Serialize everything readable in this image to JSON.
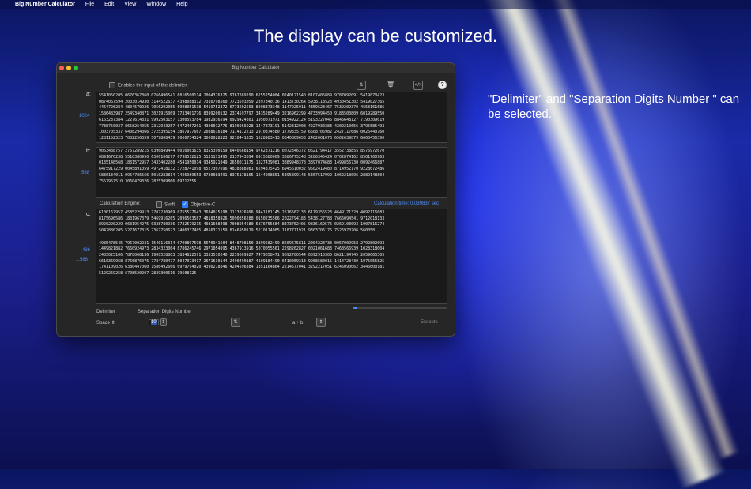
{
  "menubar": {
    "app_name": "Big Number Calculator",
    "items": [
      "File",
      "Edit",
      "View",
      "Window",
      "Help"
    ]
  },
  "headline": "The display can be customized.",
  "sidenote": "\"Delimiter\" and \"Separation Digits Number \" can be selected.",
  "window": {
    "title": "Big Number Calculator",
    "enable_delimiter_label": "Enables the input of the delimiter.",
    "a": {
      "label": "a:",
      "count": "1024",
      "text": "5541050205 0676367860 0766496541 6816500114 2004376325 9767889290 6255254084 0240121540 8107405889 9787092091 5419870423\n0874067594 2003014930 3144522637 4398088312 7310798560 7723593059 2397340736 1413730264 5938118523 4930451302 5419027365\n4464726284 4804570926 7056292055 6998051538 5419752372 6773202553 8008373348 1147925911 4359623467 7539209370 4653161686\n1586483987 2549340871 3021915069 1733401776 8399200132 2374597797 3435289449 3216962299 4733994450 9183503809 6019289550\n6163237384 1227614331 9992503157 1300593784 1932936594 0929424801 1950071971 0154922124 5193227045 8846648127 7190309019\n7738750027 8658264055 2312943257 6472467201 4300012776 8190966928 1447873191 5142312908 4227930383 4209210656 3795585493\n1003705337 6408294366 3725395154 3867977667 2088616184 7174172213 2970374580 1779335759 6608705982 2427117686 0025440760\n1281152323 7082256359 5079808439 9066734324 3000028323 9210441335 1528983413 0840809653 2402001073 6502639879 6660456390"
    },
    "b": {
      "label": "b:",
      "count": "588",
      "text": "9063438757 2767289215 6396849444 0010063635 8355390159 6440668154 9762371216 0072346372 0621794417 3552738855 8576972670\n0891670238 5518380950 6306106277 6798512125 5131171495 2137943894 0915680069 3386775248 3286345424 0702874162 8501760963\n0135148568 1831572957 3433402280 4541950014 9345921049 2650011175 1827439981 3889948378 3897074683 1499856730 0092466887\n6475917229 0045891059 4972418132 3728741098 6527307696 4838888981 6294375425 6945610032 9502419480 8714952170 9228672486\n5836134011 0964786566 5010283814 7426989553 6780083491 8375178165 1644008851 5395899143 5367517999 1062218096 2889148804\n7557957510 3060479326 7825309866 69712556"
    },
    "engine": {
      "label": "Calculation Engine:",
      "swift": "Swift",
      "objc": "Objective-C",
      "calc_time": "Calculation time: 0.039837 sec"
    },
    "c": {
      "label": "c:",
      "count1": "436",
      "count2": "...588",
      "text": "6100167957 4585229913 7707230969 0755527643 3634025198 1123826996 9441181145 2516562133 6179355523 4649171329 4092116083\n8175696586 1831967379 5469916265 2096503587 4818358926 5090856288 0150235566 2022794183 5438127788 7666094541 9712018133\n8920290229 0631954275 0338780936 1732579215 4081668498 7008954680 5876755684 8373752405 9836169576 0269103093 1907816274\n5042880205 5271677815 2367750623 2406337485 4856371159 8146950119 5210174985 1187771921 9303706175 7526970706 560058…\n\n4985478545 7967002231 1540116014 0700897598 5670941604 8448708150 3899582499 8669675811 2004223733 0057009958 2792802093\n1449821882 7660924973 2834323064 8786245746 2971054995 4367913916 5070055561 2298262827 0021061683 7468566939 1028318004\n2485025106 7878008136 1900528803 3834822591 3353510240 2259009927 7479658471 9692700544 6092910300 8621194745 2059665305\n6610369968 8766876076 7784780477 8047073417 2671530144 2490490187 4109184490 6410069313 9968580015 1414728430 1975055825\n1741109026 6380447060 1586492666 0979794020 4390278846 4204596384 1851164864 2214577041 3292217051 6245090062 3446600181\n5129269258 6708520207 2839300616 19608125"
    },
    "delimiter": {
      "label": "Delimiter",
      "value": "Space"
    },
    "separation": {
      "label": "Separation Digits Number",
      "value": "10"
    },
    "operation": "a ÷ b",
    "execute": "Execute",
    "progress": 0.03
  }
}
